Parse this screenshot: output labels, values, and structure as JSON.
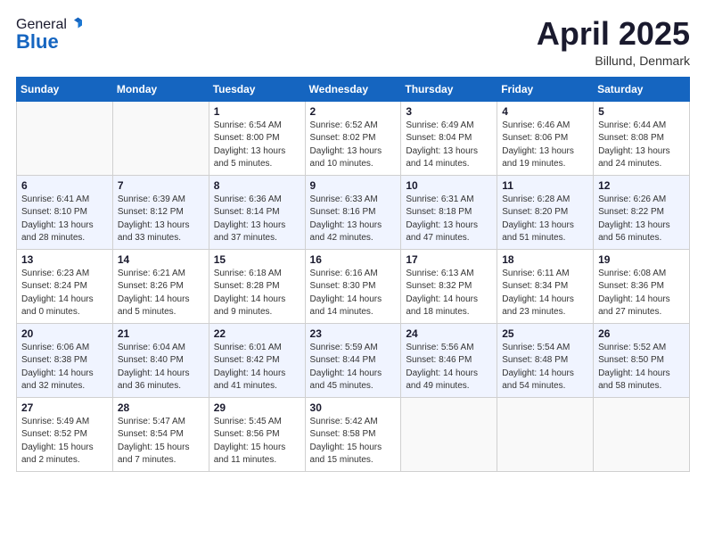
{
  "header": {
    "logo": {
      "general": "General",
      "blue": "Blue"
    },
    "month": "April 2025",
    "location": "Billund, Denmark"
  },
  "calendar": {
    "days_of_week": [
      "Sunday",
      "Monday",
      "Tuesday",
      "Wednesday",
      "Thursday",
      "Friday",
      "Saturday"
    ],
    "weeks": [
      [
        {
          "day": "",
          "info": ""
        },
        {
          "day": "",
          "info": ""
        },
        {
          "day": "1",
          "info": "Sunrise: 6:54 AM\nSunset: 8:00 PM\nDaylight: 13 hours and 5 minutes."
        },
        {
          "day": "2",
          "info": "Sunrise: 6:52 AM\nSunset: 8:02 PM\nDaylight: 13 hours and 10 minutes."
        },
        {
          "day": "3",
          "info": "Sunrise: 6:49 AM\nSunset: 8:04 PM\nDaylight: 13 hours and 14 minutes."
        },
        {
          "day": "4",
          "info": "Sunrise: 6:46 AM\nSunset: 8:06 PM\nDaylight: 13 hours and 19 minutes."
        },
        {
          "day": "5",
          "info": "Sunrise: 6:44 AM\nSunset: 8:08 PM\nDaylight: 13 hours and 24 minutes."
        }
      ],
      [
        {
          "day": "6",
          "info": "Sunrise: 6:41 AM\nSunset: 8:10 PM\nDaylight: 13 hours and 28 minutes."
        },
        {
          "day": "7",
          "info": "Sunrise: 6:39 AM\nSunset: 8:12 PM\nDaylight: 13 hours and 33 minutes."
        },
        {
          "day": "8",
          "info": "Sunrise: 6:36 AM\nSunset: 8:14 PM\nDaylight: 13 hours and 37 minutes."
        },
        {
          "day": "9",
          "info": "Sunrise: 6:33 AM\nSunset: 8:16 PM\nDaylight: 13 hours and 42 minutes."
        },
        {
          "day": "10",
          "info": "Sunrise: 6:31 AM\nSunset: 8:18 PM\nDaylight: 13 hours and 47 minutes."
        },
        {
          "day": "11",
          "info": "Sunrise: 6:28 AM\nSunset: 8:20 PM\nDaylight: 13 hours and 51 minutes."
        },
        {
          "day": "12",
          "info": "Sunrise: 6:26 AM\nSunset: 8:22 PM\nDaylight: 13 hours and 56 minutes."
        }
      ],
      [
        {
          "day": "13",
          "info": "Sunrise: 6:23 AM\nSunset: 8:24 PM\nDaylight: 14 hours and 0 minutes."
        },
        {
          "day": "14",
          "info": "Sunrise: 6:21 AM\nSunset: 8:26 PM\nDaylight: 14 hours and 5 minutes."
        },
        {
          "day": "15",
          "info": "Sunrise: 6:18 AM\nSunset: 8:28 PM\nDaylight: 14 hours and 9 minutes."
        },
        {
          "day": "16",
          "info": "Sunrise: 6:16 AM\nSunset: 8:30 PM\nDaylight: 14 hours and 14 minutes."
        },
        {
          "day": "17",
          "info": "Sunrise: 6:13 AM\nSunset: 8:32 PM\nDaylight: 14 hours and 18 minutes."
        },
        {
          "day": "18",
          "info": "Sunrise: 6:11 AM\nSunset: 8:34 PM\nDaylight: 14 hours and 23 minutes."
        },
        {
          "day": "19",
          "info": "Sunrise: 6:08 AM\nSunset: 8:36 PM\nDaylight: 14 hours and 27 minutes."
        }
      ],
      [
        {
          "day": "20",
          "info": "Sunrise: 6:06 AM\nSunset: 8:38 PM\nDaylight: 14 hours and 32 minutes."
        },
        {
          "day": "21",
          "info": "Sunrise: 6:04 AM\nSunset: 8:40 PM\nDaylight: 14 hours and 36 minutes."
        },
        {
          "day": "22",
          "info": "Sunrise: 6:01 AM\nSunset: 8:42 PM\nDaylight: 14 hours and 41 minutes."
        },
        {
          "day": "23",
          "info": "Sunrise: 5:59 AM\nSunset: 8:44 PM\nDaylight: 14 hours and 45 minutes."
        },
        {
          "day": "24",
          "info": "Sunrise: 5:56 AM\nSunset: 8:46 PM\nDaylight: 14 hours and 49 minutes."
        },
        {
          "day": "25",
          "info": "Sunrise: 5:54 AM\nSunset: 8:48 PM\nDaylight: 14 hours and 54 minutes."
        },
        {
          "day": "26",
          "info": "Sunrise: 5:52 AM\nSunset: 8:50 PM\nDaylight: 14 hours and 58 minutes."
        }
      ],
      [
        {
          "day": "27",
          "info": "Sunrise: 5:49 AM\nSunset: 8:52 PM\nDaylight: 15 hours and 2 minutes."
        },
        {
          "day": "28",
          "info": "Sunrise: 5:47 AM\nSunset: 8:54 PM\nDaylight: 15 hours and 7 minutes."
        },
        {
          "day": "29",
          "info": "Sunrise: 5:45 AM\nSunset: 8:56 PM\nDaylight: 15 hours and 11 minutes."
        },
        {
          "day": "30",
          "info": "Sunrise: 5:42 AM\nSunset: 8:58 PM\nDaylight: 15 hours and 15 minutes."
        },
        {
          "day": "",
          "info": ""
        },
        {
          "day": "",
          "info": ""
        },
        {
          "day": "",
          "info": ""
        }
      ]
    ]
  }
}
